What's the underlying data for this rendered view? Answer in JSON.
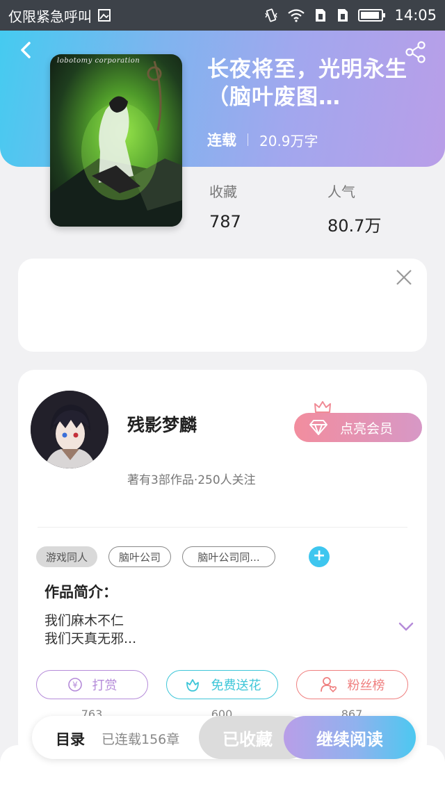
{
  "status_bar": {
    "carrier": "仅限紧急呼叫",
    "time": "14:05",
    "icons": [
      "image-icon",
      "vibrate-icon",
      "wifi-icon",
      "sim-icon",
      "sim-icon",
      "battery-icon"
    ]
  },
  "book": {
    "title": "长夜将至，光明永生（脑叶废图…",
    "status": "连载",
    "word_count": "20.9万字",
    "cover_text": "lobotomy corporation"
  },
  "stats": {
    "favorites_label": "收藏",
    "favorites_value": "787",
    "popularity_label": "人气",
    "popularity_value": "80.7万"
  },
  "author": {
    "name": "残影梦麟",
    "info": "著有3部作品·250人关注",
    "vip_label": "点亮会员"
  },
  "tags": [
    "游戏同人",
    "脑叶公司",
    "脑叶公司同..."
  ],
  "intro": {
    "title": "作品简介：",
    "lines": [
      "我们麻木不仁",
      "我们天真无邪..."
    ]
  },
  "actions": [
    {
      "label": "打赏",
      "count": "763",
      "color": "#b58bd9"
    },
    {
      "label": "免费送花",
      "count": "600",
      "color": "#3ec6d8"
    },
    {
      "label": "粉丝榜",
      "count": "867",
      "color": "#ef7f7f"
    }
  ],
  "bottom": {
    "toc_label": "目录",
    "chapters": "已连载156章",
    "collected_label": "已收藏",
    "continue_label": "继续阅读"
  },
  "colors": {
    "accent_blue": "#45cbf0",
    "accent_purple": "#b99ee8"
  }
}
